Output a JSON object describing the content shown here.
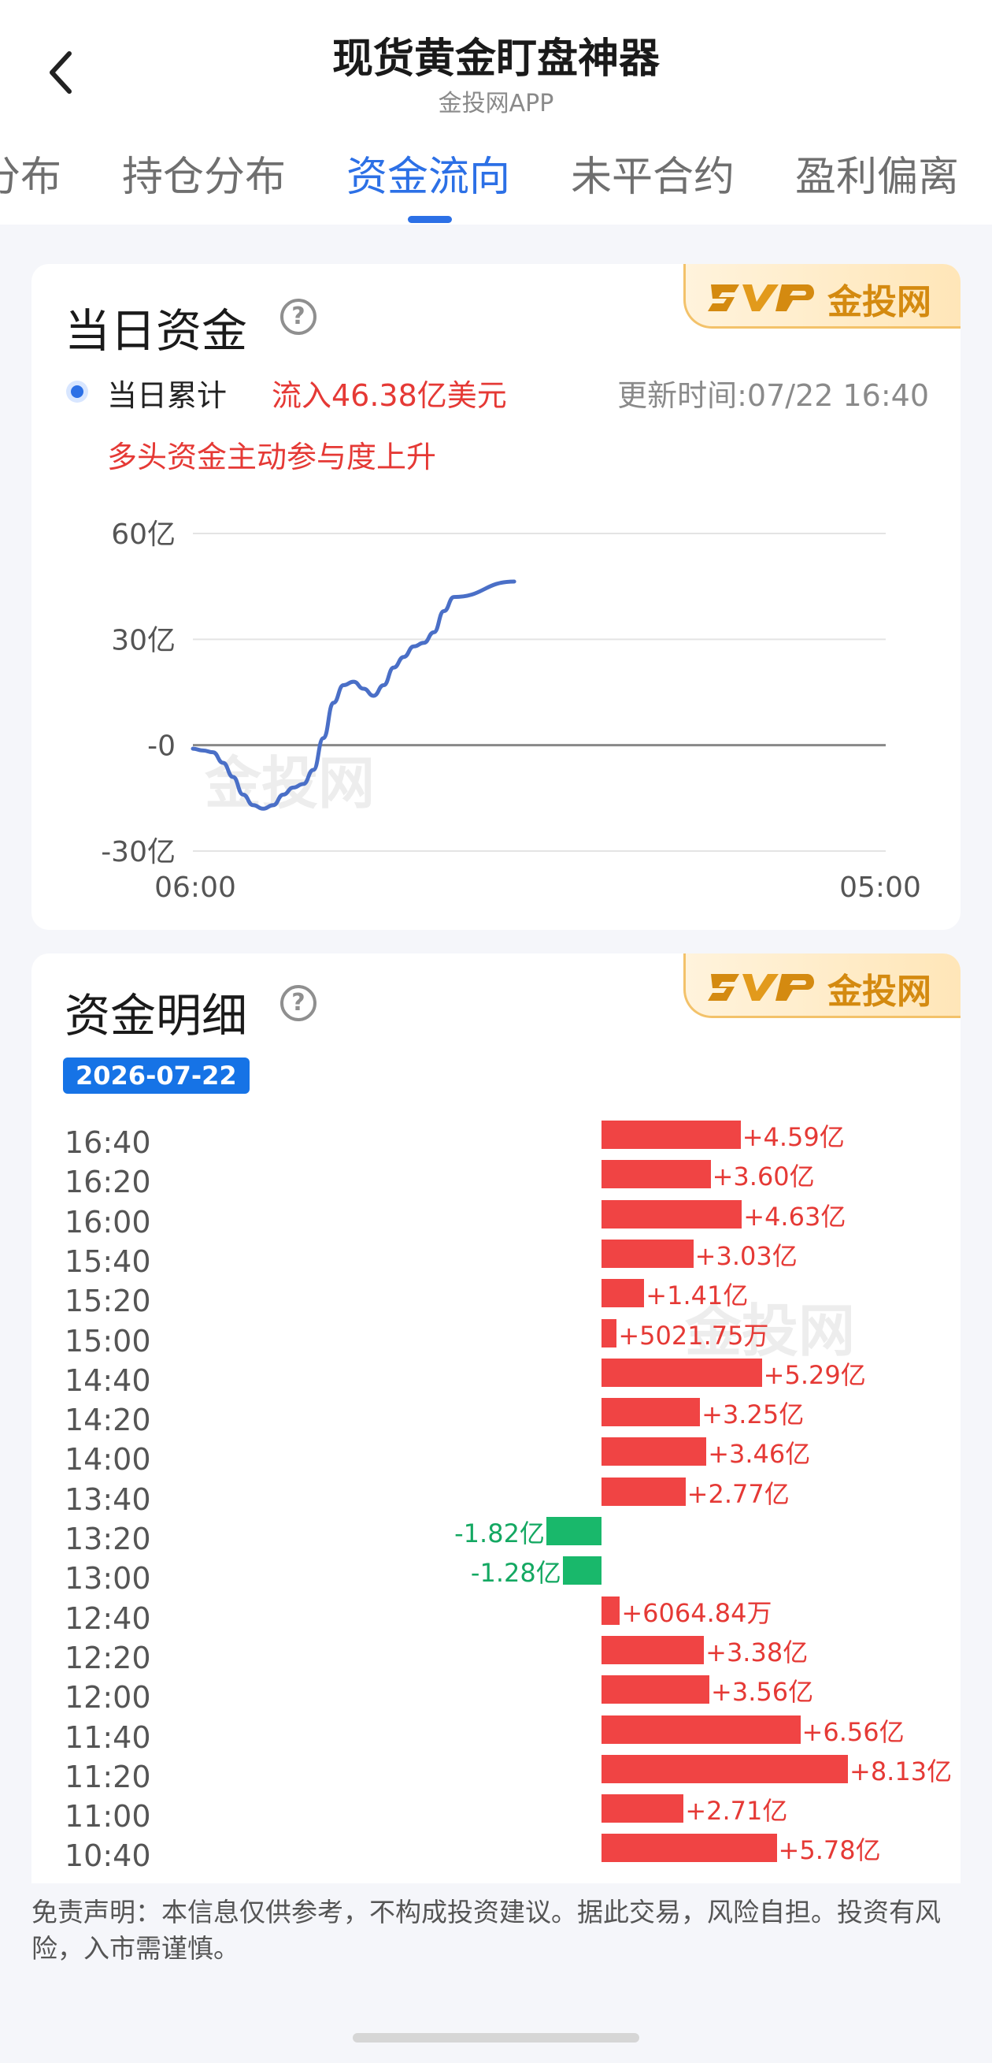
{
  "header": {
    "title": "现货黄金盯盘神器",
    "subtitle": "金投网APP"
  },
  "tabs": [
    {
      "label": "分布"
    },
    {
      "label": "持仓分布"
    },
    {
      "label": "资金流向",
      "active": true
    },
    {
      "label": "未平合约"
    },
    {
      "label": "盈利偏离"
    }
  ],
  "brand": {
    "badge_text": "金投网",
    "watermark_text": "金投网",
    "accent": "#2c70e6",
    "up_color": "#f04444",
    "down_color": "#19b86b"
  },
  "daily": {
    "title": "当日资金",
    "help_icon": "question-circle-icon",
    "legend_label": "当日累计",
    "flow_text": "流入46.38亿美元",
    "update_time": "更新时间:07/22 16:40",
    "trend_text": "多头资金主动参与度上升"
  },
  "chart_data": {
    "type": "line",
    "y_ticks": [
      "60亿",
      "30亿",
      "-0",
      "-30亿"
    ],
    "x_ticks": [
      "06:00",
      "05:00"
    ],
    "ylim": [
      -30,
      60
    ],
    "x_range": [
      "06:00",
      "05:00 (next day)"
    ],
    "grid": true,
    "series": [
      {
        "values": [
          -1,
          -1.5,
          -2,
          -5,
          -9,
          -14,
          -17,
          -18,
          -17,
          -14,
          -12,
          -11,
          -7,
          2,
          12,
          17,
          18,
          16,
          14,
          17,
          22,
          25,
          28,
          29,
          32,
          38,
          42,
          46.38
        ],
        "x": [
          "06:00",
          "06:20",
          "06:40",
          "07:00",
          "07:20",
          "07:40",
          "08:00",
          "08:20",
          "08:40",
          "09:00",
          "09:20",
          "09:40",
          "10:00",
          "10:20",
          "10:40",
          "11:00",
          "11:20",
          "11:40",
          "12:00",
          "12:20",
          "12:40",
          "13:00",
          "13:20",
          "13:40",
          "14:00",
          "14:20",
          "14:40",
          "16:40"
        ]
      }
    ]
  },
  "detail": {
    "title": "资金明细",
    "help_icon": "question-circle-icon",
    "date": "2026-07-22",
    "rows": [
      {
        "time": "16:40",
        "label": "+4.59亿",
        "value": 4.59
      },
      {
        "time": "16:20",
        "label": "+3.60亿",
        "value": 3.6
      },
      {
        "time": "16:00",
        "label": "+4.63亿",
        "value": 4.63
      },
      {
        "time": "15:40",
        "label": "+3.03亿",
        "value": 3.03
      },
      {
        "time": "15:20",
        "label": "+1.41亿",
        "value": 1.41
      },
      {
        "time": "15:00",
        "label": "+5021.75万",
        "value": 0.502
      },
      {
        "time": "14:40",
        "label": "+5.29亿",
        "value": 5.29
      },
      {
        "time": "14:20",
        "label": "+3.25亿",
        "value": 3.25
      },
      {
        "time": "14:00",
        "label": "+3.46亿",
        "value": 3.46
      },
      {
        "time": "13:40",
        "label": "+2.77亿",
        "value": 2.77
      },
      {
        "time": "13:20",
        "label": "-1.82亿",
        "value": -1.82
      },
      {
        "time": "13:00",
        "label": "-1.28亿",
        "value": -1.28
      },
      {
        "time": "12:40",
        "label": "+6064.84万",
        "value": 0.606
      },
      {
        "time": "12:20",
        "label": "+3.38亿",
        "value": 3.38
      },
      {
        "time": "12:00",
        "label": "+3.56亿",
        "value": 3.56
      },
      {
        "time": "11:40",
        "label": "+6.56亿",
        "value": 6.56
      },
      {
        "time": "11:20",
        "label": "+8.13亿",
        "value": 8.13
      },
      {
        "time": "11:00",
        "label": "+2.71亿",
        "value": 2.71
      },
      {
        "time": "10:40",
        "label": "+5.78亿",
        "value": 5.78
      }
    ]
  },
  "disclaimer": "免责声明：本信息仅供参考，不构成投资建议。据此交易，风险自担。投资有风险，入市需谨慎。"
}
